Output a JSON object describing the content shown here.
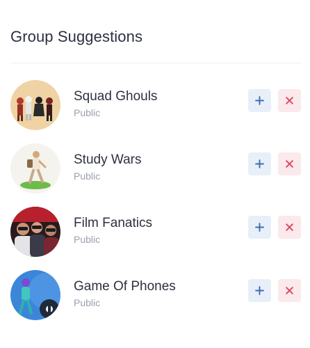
{
  "header": {
    "title": "Group Suggestions"
  },
  "groups": [
    {
      "name": "Squad Ghouls",
      "visibility": "Public",
      "avatar_icon": "halloween-group-avatar"
    },
    {
      "name": "Study Wars",
      "visibility": "Public",
      "avatar_icon": "student-walking-avatar"
    },
    {
      "name": "Film Fanatics",
      "visibility": "Public",
      "avatar_icon": "cinema-audience-avatar"
    },
    {
      "name": "Game Of Phones",
      "visibility": "Public",
      "avatar_icon": "gamer-avatar"
    }
  ],
  "colors": {
    "add_bg": "#e9eff8",
    "add_icon": "#3b6fb6",
    "remove_bg": "#fbe9ec",
    "remove_icon": "#e0485e",
    "subtext": "#9aa0ad"
  }
}
